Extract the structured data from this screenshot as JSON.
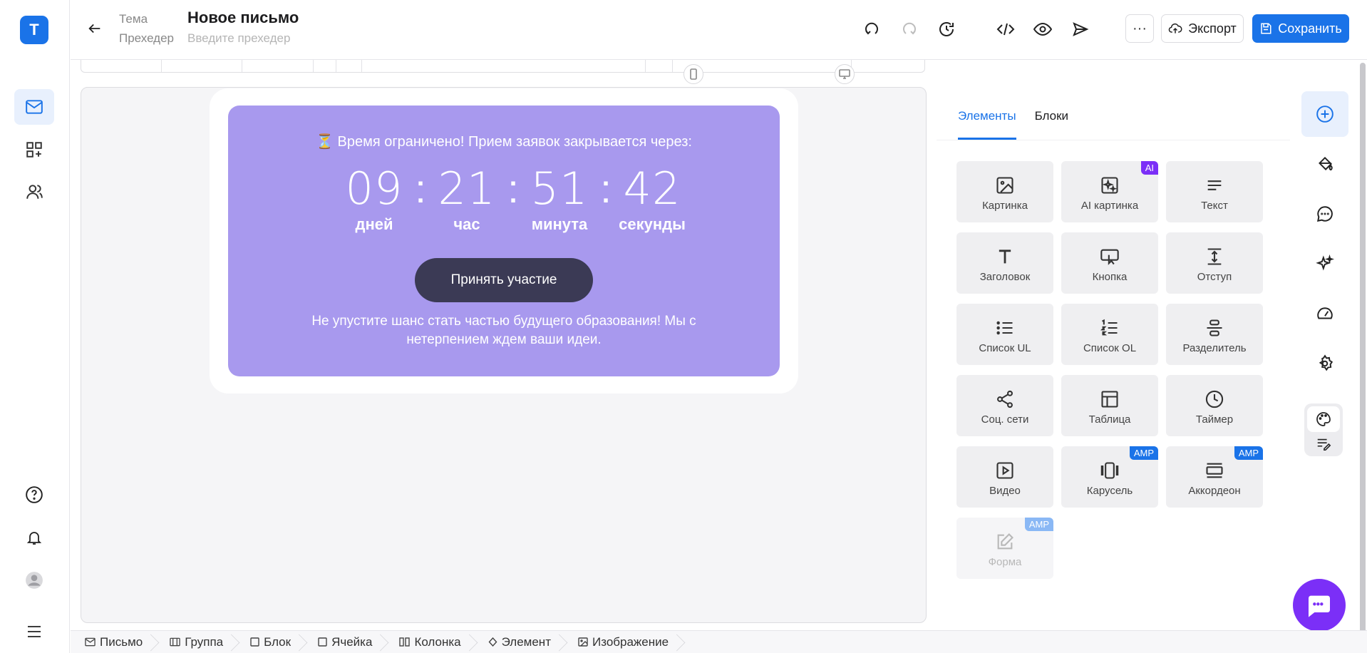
{
  "app": {
    "logo_letter": "T"
  },
  "header": {
    "subject_label": "Тема",
    "subject_value": "Новое письмо",
    "preheader_label": "Прехедер",
    "preheader_placeholder": "Введите прехедер",
    "more_label": "···",
    "export_label": "Экспорт",
    "save_label": "Сохранить"
  },
  "email": {
    "headline": "⏳ Время ограничено! Прием заявок закрывается через:",
    "countdown": [
      {
        "value": "09",
        "label": "дней"
      },
      {
        "value": "21",
        "label": "час"
      },
      {
        "value": "51",
        "label": "минута"
      },
      {
        "value": "42",
        "label": "секунды"
      }
    ],
    "separator": ":",
    "cta_label": "Принять участие",
    "body_text": "Не упустите шанс стать частью будущего образования! Мы с нетерпением ждем ваши идеи.",
    "background_color": "#a899ee",
    "cta_color": "#3b3a55"
  },
  "panel": {
    "tabs": [
      {
        "label": "Элементы"
      },
      {
        "label": "Блоки"
      }
    ],
    "tiles": [
      {
        "label": "Картинка",
        "icon": "image-icon"
      },
      {
        "label": "AI картинка",
        "icon": "ai-image-icon",
        "badge": "AI"
      },
      {
        "label": "Текст",
        "icon": "text-lines-icon"
      },
      {
        "label": "Заголовок",
        "icon": "heading-icon"
      },
      {
        "label": "Кнопка",
        "icon": "button-icon"
      },
      {
        "label": "Отступ",
        "icon": "spacer-icon"
      },
      {
        "label": "Список UL",
        "icon": "bullet-list-icon"
      },
      {
        "label": "Список OL",
        "icon": "numbered-list-icon"
      },
      {
        "label": "Разделитель",
        "icon": "divider-icon"
      },
      {
        "label": "Соц. сети",
        "icon": "share-icon"
      },
      {
        "label": "Таблица",
        "icon": "table-icon"
      },
      {
        "label": "Таймер",
        "icon": "clock-icon"
      },
      {
        "label": "Видео",
        "icon": "video-icon"
      },
      {
        "label": "Карусель",
        "icon": "carousel-icon",
        "badge": "AMP"
      },
      {
        "label": "Аккордеон",
        "icon": "accordion-icon",
        "badge": "AMP"
      },
      {
        "label": "Форма",
        "icon": "form-icon",
        "badge": "AMP"
      }
    ]
  },
  "breadcrumb": [
    {
      "label": "Письмо",
      "icon": "mail-icon"
    },
    {
      "label": "Группа",
      "icon": "group-icon"
    },
    {
      "label": "Блок",
      "icon": "block-icon"
    },
    {
      "label": "Ячейка",
      "icon": "cell-icon"
    },
    {
      "label": "Колонка",
      "icon": "columns-icon"
    },
    {
      "label": "Элемент",
      "icon": "element-icon"
    },
    {
      "label": "Изображение",
      "icon": "image-icon"
    }
  ],
  "colors": {
    "accent": "#1a73e8",
    "ai_badge": "#7b2ff7",
    "chat_fab": "#7b2ff7"
  }
}
